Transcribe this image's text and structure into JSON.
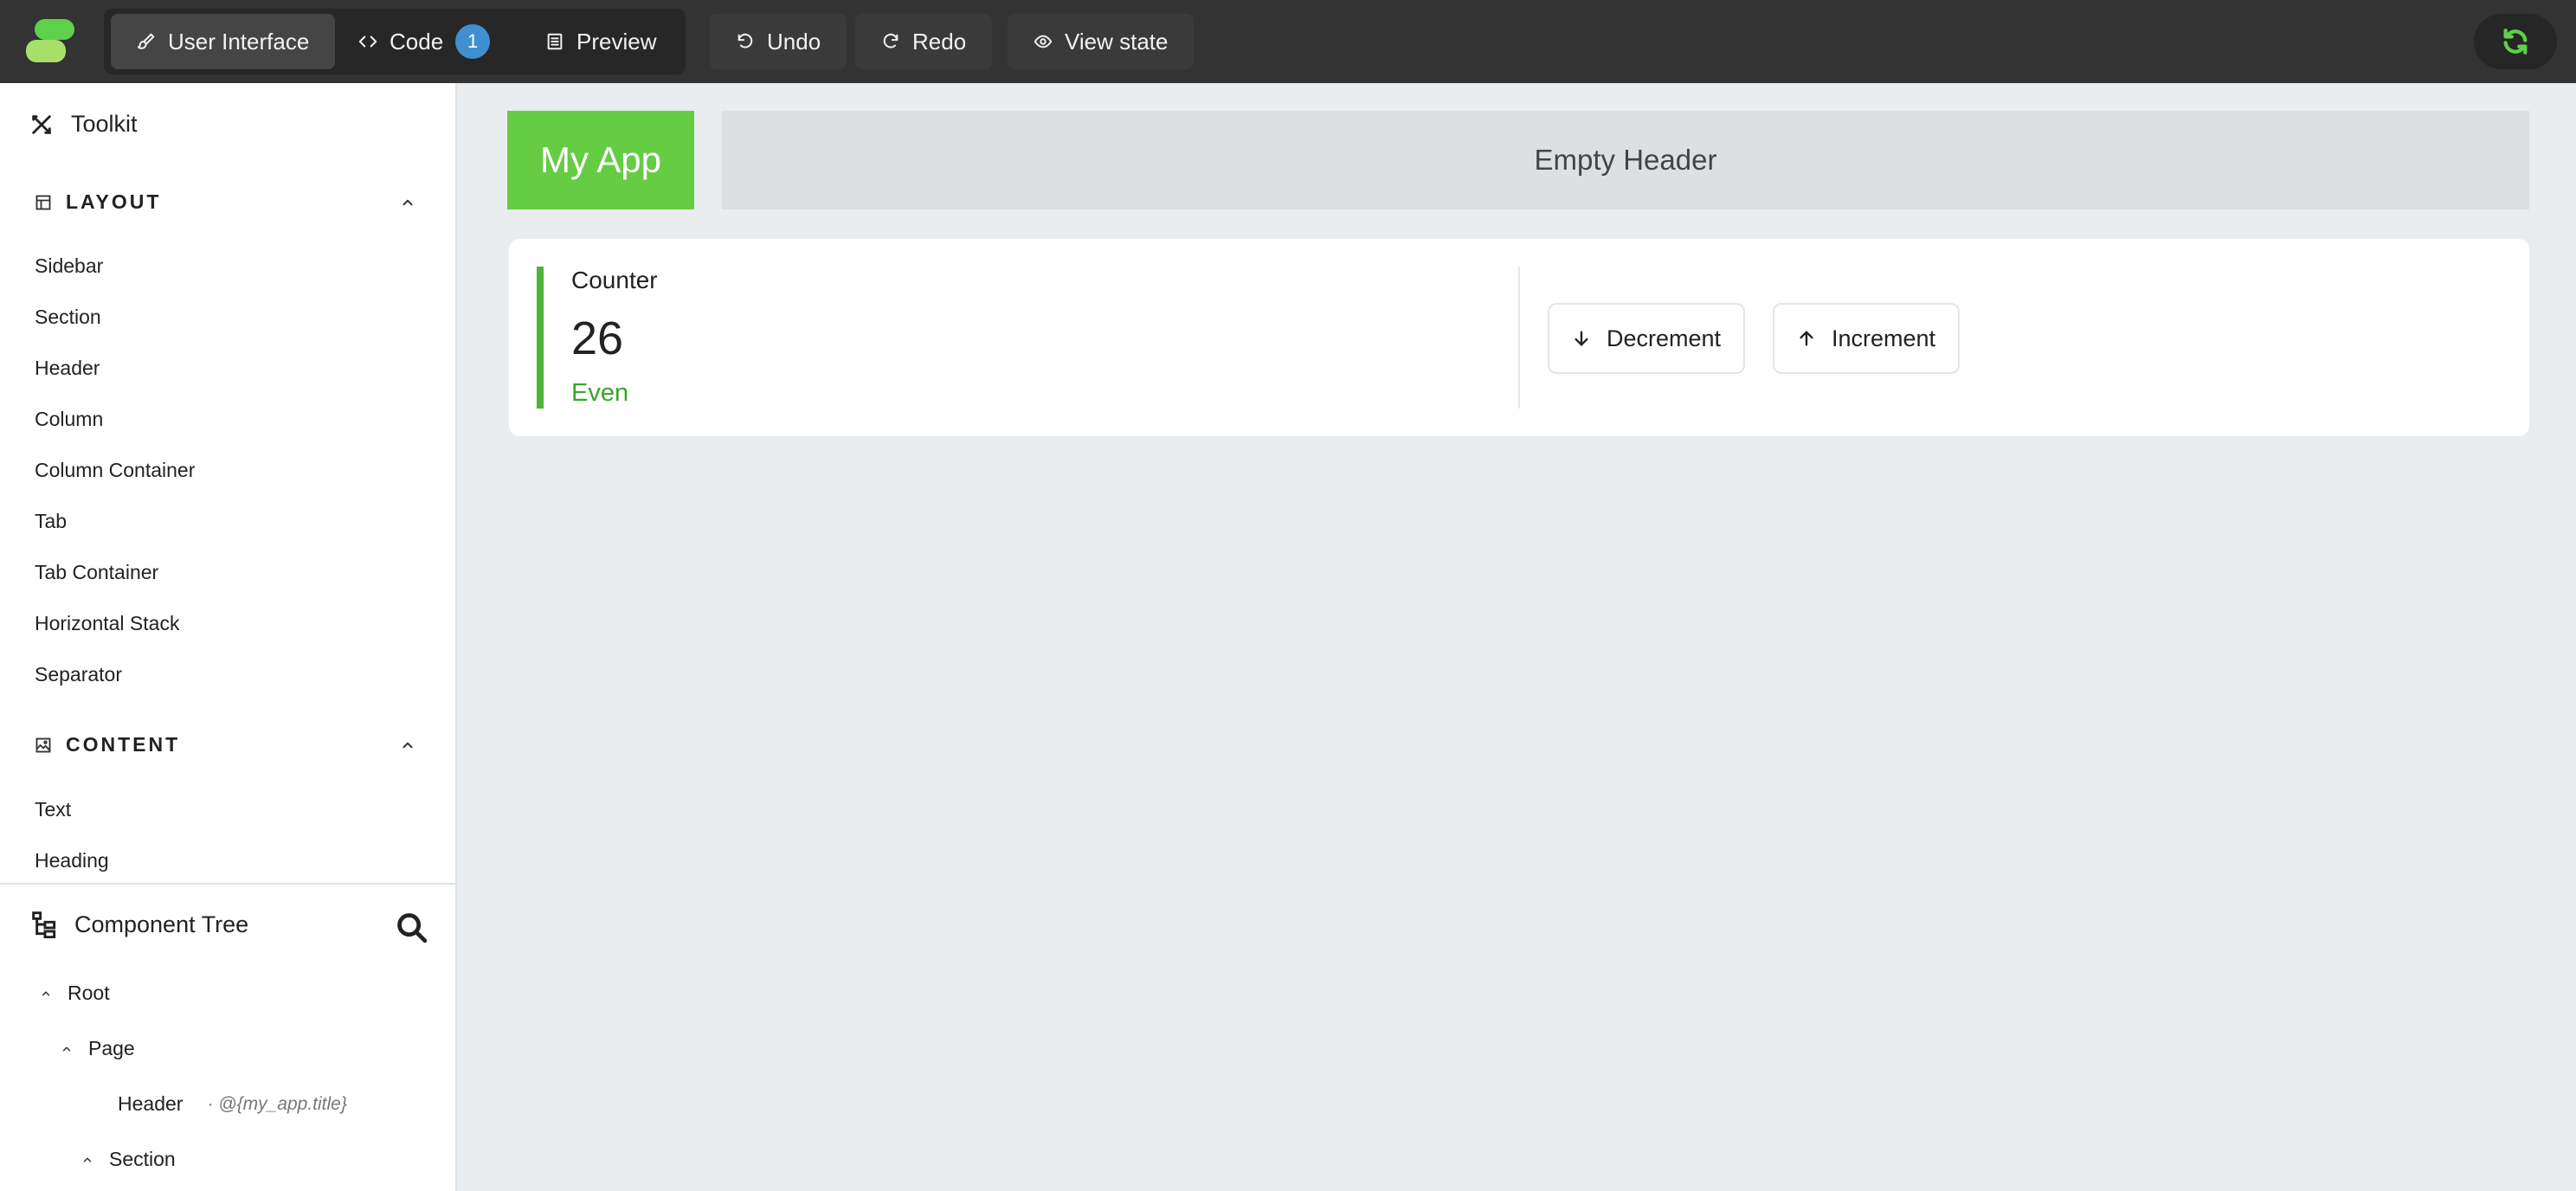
{
  "toolbar": {
    "user_interface": "User Interface",
    "code": "Code",
    "code_badge": "1",
    "preview": "Preview",
    "undo": "Undo",
    "redo": "Redo",
    "view_state": "View state"
  },
  "toolkit": {
    "title": "Toolkit",
    "layout": {
      "title": "LAYOUT",
      "items": [
        "Sidebar",
        "Section",
        "Header",
        "Column",
        "Column Container",
        "Tab",
        "Tab Container",
        "Horizontal Stack",
        "Separator"
      ]
    },
    "content": {
      "title": "CONTENT",
      "items": [
        "Text",
        "Heading"
      ]
    }
  },
  "component_tree": {
    "title": "Component Tree",
    "nodes": [
      {
        "label": "Root"
      },
      {
        "label": "Page"
      },
      {
        "label": "Header",
        "sub": "· @{my_app.title}"
      },
      {
        "label": "Section"
      }
    ]
  },
  "canvas": {
    "app_title": "My App",
    "empty_header": "Empty Header",
    "counter": {
      "label": "Counter",
      "value": "26",
      "parity": "Even",
      "decrement": "Decrement",
      "increment": "Increment"
    }
  },
  "colors": {
    "accent_green": "#66cc44",
    "topbar": "#333333",
    "badge_blue": "#3f8fd1"
  }
}
